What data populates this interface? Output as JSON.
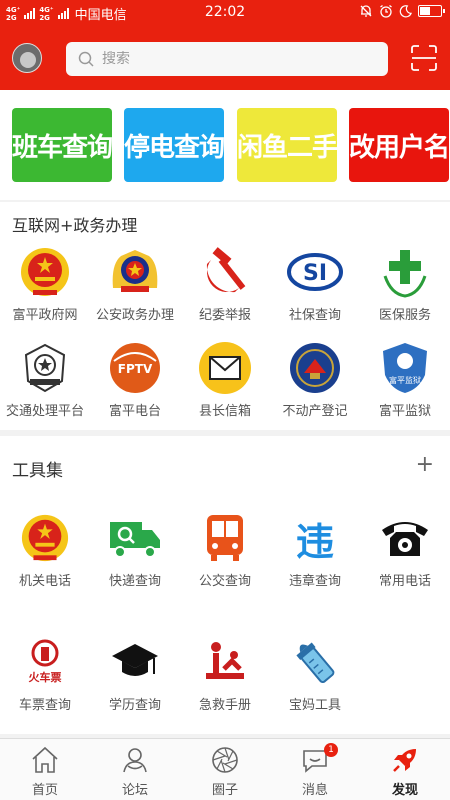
{
  "status_bar": {
    "network_top": "4G⁺",
    "network_bottom": "2G",
    "network_top2": "4G⁺",
    "network_bottom2": "2G",
    "carrier": "中国电信",
    "time": "22:02",
    "battery_level": 0.55
  },
  "header": {
    "search_placeholder": "搜索",
    "accent_color": "#e8210f"
  },
  "banners": [
    {
      "label": "班车查询",
      "color": "#3cb832"
    },
    {
      "label": "停电查询",
      "color": "#1ea8ee"
    },
    {
      "label": "闲鱼二手",
      "color": "#eee83a"
    },
    {
      "label": "改用户名",
      "color": "#e8150d"
    }
  ],
  "gov_section": {
    "title": "互联网+政务办理",
    "items": [
      {
        "label": "富平政府网",
        "icon": "national-emblem-icon"
      },
      {
        "label": "公安政务办理",
        "icon": "police-emblem-icon"
      },
      {
        "label": "纪委举报",
        "icon": "hammer-sickle-icon"
      },
      {
        "label": "社保查询",
        "icon": "social-security-logo-icon"
      },
      {
        "label": "医保服务",
        "icon": "medical-cross-icon"
      },
      {
        "label": "交通处理平台",
        "icon": "traffic-police-emblem-icon"
      },
      {
        "label": "富平电台",
        "icon": "fptv-logo-icon",
        "logo_text": "FPTV"
      },
      {
        "label": "县长信箱",
        "icon": "mail-envelope-icon"
      },
      {
        "label": "不动产登记",
        "icon": "real-estate-badge-icon"
      },
      {
        "label": "富平监狱",
        "icon": "prison-shield-icon",
        "logo_text": "富平监狱"
      }
    ]
  },
  "tools_section": {
    "title": "工具集",
    "add_label": "+",
    "items": [
      {
        "label": "机关电话",
        "icon": "national-emblem-icon"
      },
      {
        "label": "快递查询",
        "icon": "delivery-truck-icon"
      },
      {
        "label": "公交查询",
        "icon": "bus-icon"
      },
      {
        "label": "违章查询",
        "icon": "violation-char-icon",
        "glyph": "违"
      },
      {
        "label": "常用电话",
        "icon": "telephone-icon"
      },
      {
        "label": "车票查询",
        "icon": "train-ticket-icon",
        "logo_text": "火车票"
      },
      {
        "label": "学历查询",
        "icon": "graduation-cap-icon"
      },
      {
        "label": "急救手册",
        "icon": "first-aid-icon"
      },
      {
        "label": "宝妈工具",
        "icon": "baby-bottle-icon"
      }
    ]
  },
  "bottom_nav": {
    "items": [
      {
        "label": "首页",
        "icon": "home-icon"
      },
      {
        "label": "论坛",
        "icon": "forum-icon"
      },
      {
        "label": "圈子",
        "icon": "aperture-icon"
      },
      {
        "label": "消息",
        "icon": "message-icon",
        "badge": "1"
      },
      {
        "label": "发现",
        "icon": "rocket-icon",
        "active": true
      }
    ]
  }
}
